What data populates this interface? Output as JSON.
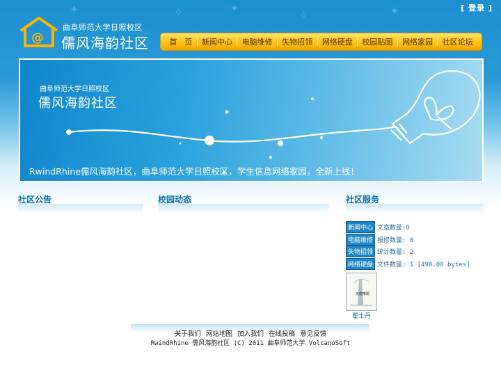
{
  "header": {
    "login_label": "[ 登录 ]",
    "school_name": "曲阜师范大学日照校区",
    "site_title": "儒风海韵社区"
  },
  "nav": {
    "items": [
      {
        "label": "首　页"
      },
      {
        "label": "新闻中心"
      },
      {
        "label": "电脑维修"
      },
      {
        "label": "失物招领"
      },
      {
        "label": "网络硬盘"
      },
      {
        "label": "校园贴图"
      },
      {
        "label": "网络家园"
      },
      {
        "label": "社区论坛"
      }
    ]
  },
  "banner": {
    "subtitle": "曲阜师范大学日照校区",
    "title": "儒风海韵社区",
    "slogan": "RwindRhine儒风海韵社区，曲阜师范大学日照校区，学生信息网络家园，全新上线！"
  },
  "sections": {
    "notice_title": "社区公告",
    "campus_title": "校园动态",
    "service_title": "社区服务"
  },
  "services": [
    {
      "badge": "新闻中心",
      "text": "文章数量:0"
    },
    {
      "badge": "电脑维修",
      "text": "报修数量: 0"
    },
    {
      "badge": "失物招领",
      "text": "统计数量: 2"
    },
    {
      "badge": "网络硬盘",
      "text": "文件数量: 1 [490.00 bytes]"
    }
  ],
  "book": {
    "cover_text": "无题唯题",
    "caption": "瞿士丹"
  },
  "footer": {
    "links": [
      {
        "label": "关于我们"
      },
      {
        "label": "网站地图"
      },
      {
        "label": "加入我们"
      },
      {
        "label": "在线投稿"
      },
      {
        "label": "意见反馈"
      }
    ],
    "copyright": "RwindRhine 儒风海韵社区 (C) 2011 曲阜师范大学 VolcanoSoft"
  },
  "colors": {
    "header_blue": "#1c8fd0",
    "nav_orange": "#ffc51c",
    "section_title": "#0f6fb0",
    "badge_blue": "#1f88c6"
  }
}
